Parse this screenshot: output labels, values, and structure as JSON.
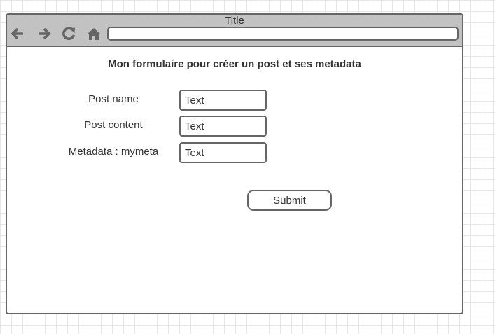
{
  "window": {
    "title": "Title",
    "address": ""
  },
  "icons": {
    "back": "arrow-left-icon",
    "forward": "arrow-right-icon",
    "refresh": "refresh-icon",
    "home": "home-icon"
  },
  "form": {
    "title": "Mon formulaire pour créer un post et ses metadata",
    "fields": [
      {
        "label": "Post name",
        "placeholder": "Text"
      },
      {
        "label": "Post content",
        "placeholder": "Text"
      },
      {
        "label": "Metadata : mymeta",
        "placeholder": "Text"
      }
    ],
    "submit_label": "Submit"
  },
  "colors": {
    "titlebar": "#c2c2c2",
    "border": "#666666",
    "text": "#333333"
  }
}
